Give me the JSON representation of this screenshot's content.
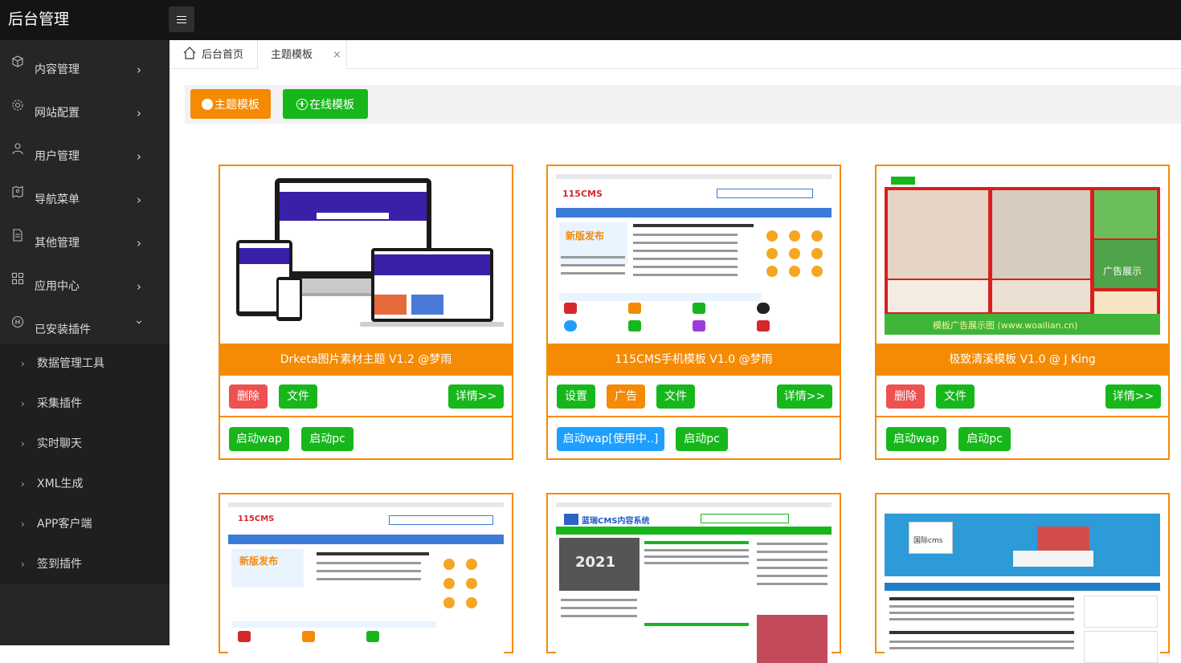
{
  "brand": "后台管理",
  "sidebar": {
    "items": [
      {
        "label": "内容管理",
        "icon": "cube-icon"
      },
      {
        "label": "网站配置",
        "icon": "gear-icon"
      },
      {
        "label": "用户管理",
        "icon": "user-icon"
      },
      {
        "label": "导航菜单",
        "icon": "map-icon"
      },
      {
        "label": "其他管理",
        "icon": "file-icon"
      },
      {
        "label": "应用中心",
        "icon": "grid-icon"
      },
      {
        "label": "已安装插件",
        "icon": "plugin-icon"
      }
    ],
    "plugins": [
      "数据管理工具",
      "采集插件",
      "实时聊天",
      "XML生成",
      "APP客户端",
      "签到插件"
    ]
  },
  "tabs": {
    "home": "后台首页",
    "active": "主题模板",
    "close": "×"
  },
  "toolbar": {
    "theme_button": "主题模板",
    "online_button": "在线模板"
  },
  "cards": [
    {
      "title": "Drketa图片素材主题 V1.2 @梦雨",
      "row1": [
        "删除",
        "文件"
      ],
      "detail": "详情>>",
      "row2": [
        "启动wap",
        "启动pc"
      ]
    },
    {
      "title": "115CMS手机模板 V1.0 @梦雨",
      "row1": [
        "设置",
        "广告",
        "文件"
      ],
      "detail": "详情>>",
      "row2": [
        "启动wap[使用中..]",
        "启动pc"
      ]
    },
    {
      "title": "极致清溪模板 V1.0 @ J King",
      "row1": [
        "删除",
        "文件"
      ],
      "detail": "详情>>",
      "row2": [
        "启动wap",
        "启动pc"
      ]
    }
  ],
  "thumbs": {
    "t2_logo": "115CMS",
    "t2_banner": "新版发布",
    "t3_ad": "广告展示",
    "t3_footer": "模板广告展示图 (www.woailian.cn)",
    "t5_logo": "蓝瑞CMS内容系统",
    "t5_year": "2021",
    "t6_label": "国际cms"
  },
  "colors": {
    "accent": "#f58a04",
    "green": "#17b71c",
    "red": "#ef5050",
    "blue": "#1e9fff",
    "topbar": "#141414",
    "sidebar": "#262626"
  }
}
